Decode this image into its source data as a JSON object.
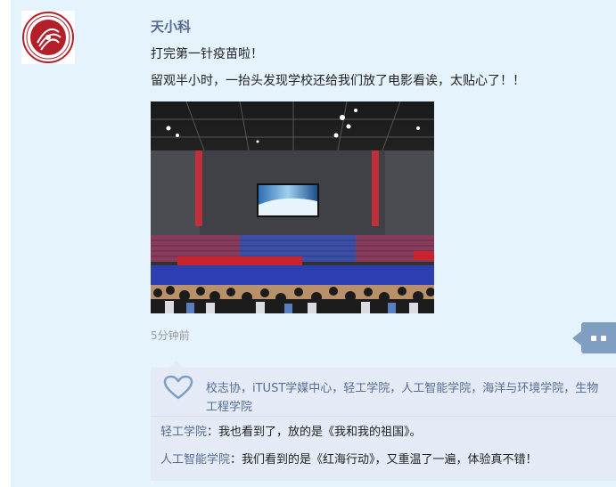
{
  "post": {
    "author": "天小科",
    "lines": [
      "打完第一针疫苗啦！",
      "留观半小时，一抬头发现学校还给我们放了电影看诶，太贴心了！！"
    ],
    "time": "5分钟前",
    "avatar": {
      "icon": "university-seal-logo",
      "color": "#b3202a"
    },
    "photo": {
      "icon": "gymnasium-photo"
    }
  },
  "likes": {
    "icon": "heart-outline-icon",
    "text": "校志协，iTUST学媒中心，轻工学院，人工智能学院，海洋与环境学院，生物工程学院"
  },
  "comments": [
    {
      "author": "轻工学院",
      "separator": "：",
      "text": "我也看到了，放的是《我和我的祖国》。"
    },
    {
      "author": "人工智能学院",
      "separator": "：",
      "text": "我们看到的是《红海行动》，又重温了一遍，体验真不错！"
    }
  ],
  "colors": {
    "background": "#e5f4fc",
    "link": "#576b95",
    "button": "#7f9ec2",
    "comment_bg": "#e4ebf6"
  }
}
